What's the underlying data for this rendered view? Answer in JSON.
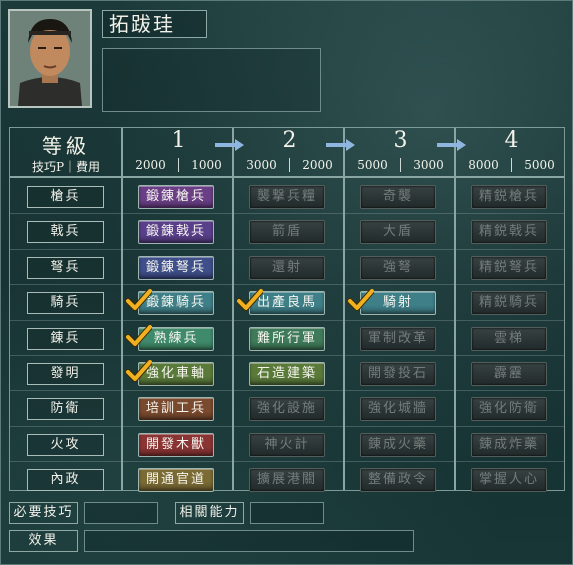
{
  "character": {
    "name": "拓跋珪",
    "portrait_icon": "officer-portrait-icon",
    "description": ""
  },
  "header": {
    "title": "等級",
    "subtitle": "技巧P｜費用",
    "levels": [
      {
        "label": "1",
        "cost_a": "2000",
        "cost_b": "1000"
      },
      {
        "label": "2",
        "cost_a": "3000",
        "cost_b": "2000"
      },
      {
        "label": "3",
        "cost_a": "5000",
        "cost_b": "3000"
      },
      {
        "label": "4",
        "cost_a": "8000",
        "cost_b": "5000"
      }
    ]
  },
  "rows": [
    {
      "label": "槍兵",
      "cells": [
        {
          "text": "鍛錬槍兵",
          "active": true,
          "checked": false,
          "color": "#6a3f86"
        },
        {
          "text": "襲撃兵糧",
          "active": false,
          "checked": false
        },
        {
          "text": "奇襲",
          "active": false,
          "checked": false
        },
        {
          "text": "精鋭槍兵",
          "active": false,
          "checked": false
        }
      ]
    },
    {
      "label": "戟兵",
      "cells": [
        {
          "text": "鍛錬戟兵",
          "active": true,
          "checked": false,
          "color": "#5a3f8a"
        },
        {
          "text": "箭盾",
          "active": false,
          "checked": false
        },
        {
          "text": "大盾",
          "active": false,
          "checked": false
        },
        {
          "text": "精鋭戟兵",
          "active": false,
          "checked": false
        }
      ]
    },
    {
      "label": "弩兵",
      "cells": [
        {
          "text": "鍛錬弩兵",
          "active": true,
          "checked": false,
          "color": "#3f4f8a"
        },
        {
          "text": "還射",
          "active": false,
          "checked": false
        },
        {
          "text": "強弩",
          "active": false,
          "checked": false
        },
        {
          "text": "精鋭弩兵",
          "active": false,
          "checked": false
        }
      ]
    },
    {
      "label": "騎兵",
      "cells": [
        {
          "text": "鍛錬騎兵",
          "active": true,
          "checked": true,
          "color": "#3f7f88"
        },
        {
          "text": "出產良馬",
          "active": true,
          "checked": true,
          "color": "#3f7f88"
        },
        {
          "text": "騎射",
          "active": true,
          "checked": true,
          "color": "#3f7f88"
        },
        {
          "text": "精鋭騎兵",
          "active": false,
          "checked": false
        }
      ]
    },
    {
      "label": "錬兵",
      "cells": [
        {
          "text": "熟練兵",
          "active": true,
          "checked": true,
          "color": "#3f8a6a"
        },
        {
          "text": "難所行軍",
          "active": true,
          "checked": false,
          "color": "#3f7a5a"
        },
        {
          "text": "軍制改革",
          "active": false,
          "checked": false
        },
        {
          "text": "雲梯",
          "active": false,
          "checked": false
        }
      ]
    },
    {
      "label": "發明",
      "cells": [
        {
          "text": "強化車軸",
          "active": true,
          "checked": true,
          "color": "#5a7a3a"
        },
        {
          "text": "石造建築",
          "active": true,
          "checked": false,
          "color": "#5a7a3a"
        },
        {
          "text": "開發投石",
          "active": false,
          "checked": false
        },
        {
          "text": "霹靂",
          "active": false,
          "checked": false
        }
      ]
    },
    {
      "label": "防衛",
      "cells": [
        {
          "text": "培訓工兵",
          "active": true,
          "checked": false,
          "color": "#7a4a2e"
        },
        {
          "text": "強化設施",
          "active": false,
          "checked": false
        },
        {
          "text": "強化城牆",
          "active": false,
          "checked": false
        },
        {
          "text": "強化防衛",
          "active": false,
          "checked": false
        }
      ]
    },
    {
      "label": "火攻",
      "cells": [
        {
          "text": "開發木獸",
          "active": true,
          "checked": false,
          "color": "#8a3434"
        },
        {
          "text": "神火計",
          "active": false,
          "checked": false
        },
        {
          "text": "錬成火藥",
          "active": false,
          "checked": false
        },
        {
          "text": "錬成炸藥",
          "active": false,
          "checked": false
        }
      ]
    },
    {
      "label": "內政",
      "cells": [
        {
          "text": "開通官道",
          "active": true,
          "checked": false,
          "color": "#7a6a34"
        },
        {
          "text": "擴展港關",
          "active": false,
          "checked": false
        },
        {
          "text": "整備政令",
          "active": false,
          "checked": false
        },
        {
          "text": "掌握人心",
          "active": false,
          "checked": false
        }
      ]
    }
  ],
  "footer": {
    "required_label": "必要技巧",
    "required_value": "",
    "related_label": "相關能力",
    "related_value": "",
    "effect_label": "效果",
    "effect_value": ""
  }
}
